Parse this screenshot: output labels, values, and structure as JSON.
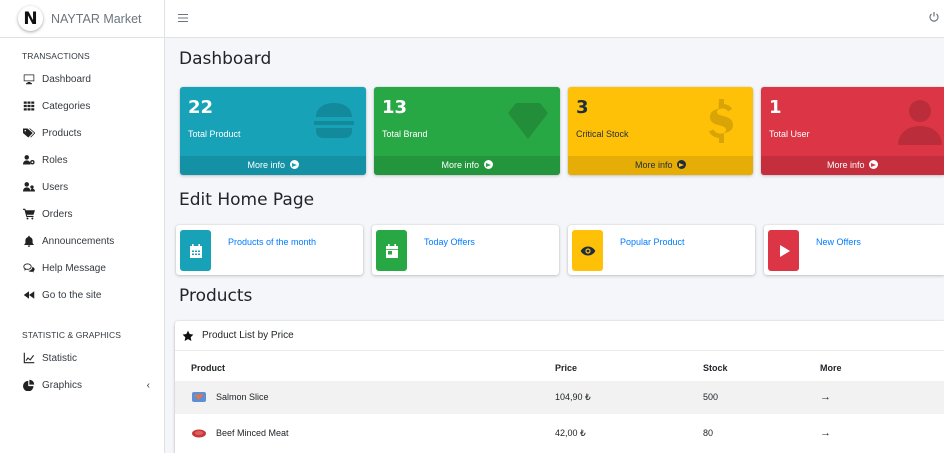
{
  "brand": {
    "logo_letter": "N",
    "name": "NAYTAR Market"
  },
  "sidebar": {
    "section1": "TRANSACTIONS",
    "items": [
      {
        "label": "Dashboard",
        "icon": "desktop-icon"
      },
      {
        "label": "Categories",
        "icon": "grid-icon"
      },
      {
        "label": "Products",
        "icon": "tags-icon"
      },
      {
        "label": "Roles",
        "icon": "users-cog-icon"
      },
      {
        "label": "Users",
        "icon": "users-icon"
      },
      {
        "label": "Orders",
        "icon": "cart-icon"
      },
      {
        "label": "Announcements",
        "icon": "bell-icon"
      },
      {
        "label": "Help Message",
        "icon": "chat-icon"
      },
      {
        "label": "Go to the site",
        "icon": "backward-icon"
      }
    ],
    "section2": "STATISTIC & GRAPHICS",
    "items2": [
      {
        "label": "Statistic",
        "icon": "line-chart-icon"
      },
      {
        "label": "Graphics",
        "icon": "pie-chart-icon",
        "caret": "‹"
      }
    ]
  },
  "page": {
    "title": "Dashboard",
    "edit_title": "Edit Home Page",
    "products_title": "Products"
  },
  "stats": [
    {
      "value": "22",
      "label": "Total Product",
      "more": "More info",
      "color": "#17a2b8",
      "icon": "burger-icon"
    },
    {
      "value": "13",
      "label": "Total Brand",
      "more": "More info",
      "color": "#28a745",
      "icon": "gem-icon"
    },
    {
      "value": "3",
      "label": "Critical Stock",
      "more": "More info",
      "color": "#ffc107",
      "icon": "dollar-icon"
    },
    {
      "value": "1",
      "label": "Total User",
      "more": "More info",
      "color": "#dc3545",
      "icon": "user-icon"
    }
  ],
  "edit_boxes": [
    {
      "label": "Products of the month",
      "color": "#17a2b8",
      "icon": "calendar-icon"
    },
    {
      "label": "Today Offers",
      "color": "#28a745",
      "icon": "calendar-day-icon"
    },
    {
      "label": "Popular Product",
      "color": "#ffc107",
      "icon": "eye-icon"
    },
    {
      "label": "New Offers",
      "color": "#dc3545",
      "icon": "play-icon"
    }
  ],
  "products_card": {
    "header": "Product List by Price",
    "columns": [
      "Product",
      "Price",
      "Stock",
      "More"
    ],
    "rows": [
      {
        "name": "Salmon Slice",
        "price": "104,90 ₺",
        "stock": "500",
        "more": "→"
      },
      {
        "name": "Beef Minced Meat",
        "price": "42,00 ₺",
        "stock": "80",
        "more": "→"
      }
    ]
  }
}
